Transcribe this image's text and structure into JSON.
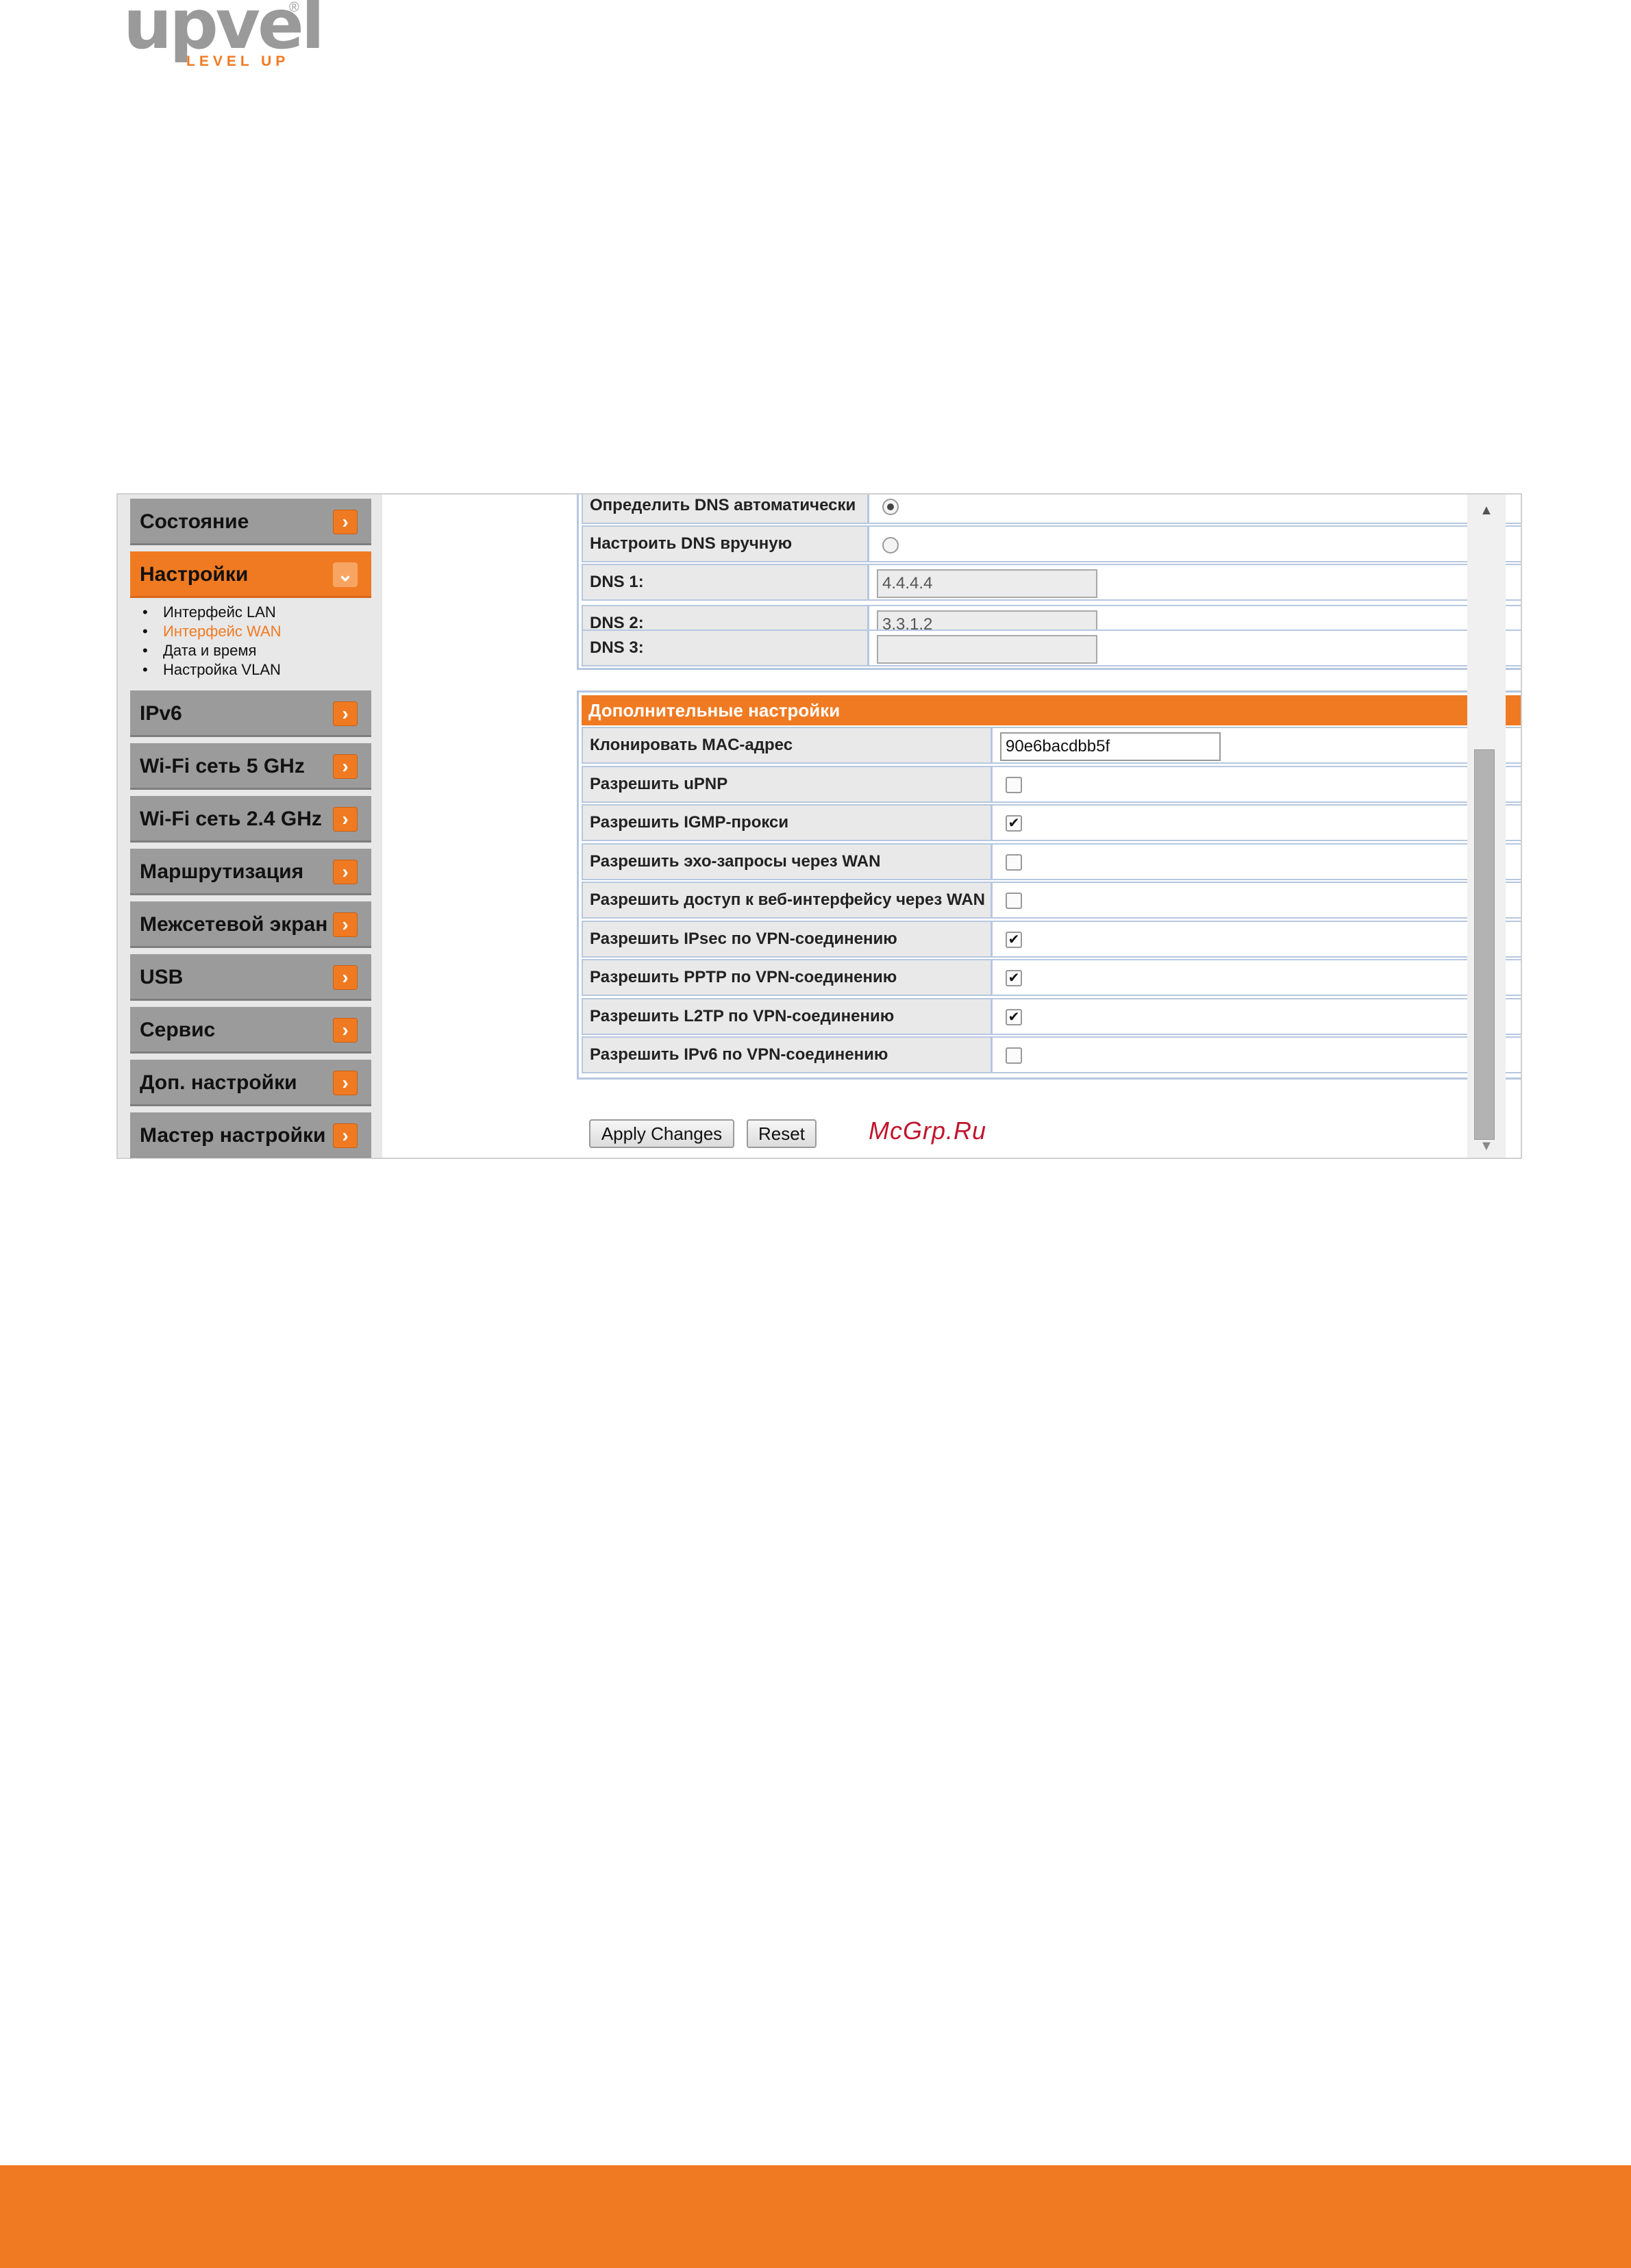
{
  "logo": {
    "brand": "upvel",
    "registered": "®",
    "tagline": "LEVEL UP"
  },
  "sidebar": {
    "items": [
      {
        "label": "Состояние",
        "icon": "chevron-right-icon"
      },
      {
        "label": "Настройки",
        "icon": "chevron-down-icon",
        "active": true
      },
      {
        "label": "IPv6",
        "icon": "chevron-right-icon"
      },
      {
        "label": "Wi-Fi сеть 5 GHz",
        "icon": "chevron-right-icon"
      },
      {
        "label": "Wi-Fi сеть 2.4 GHz",
        "icon": "chevron-right-icon"
      },
      {
        "label": "Маршрутизация",
        "icon": "chevron-right-icon"
      },
      {
        "label": "Межсетевой экран",
        "icon": "chevron-right-icon"
      },
      {
        "label": "USB",
        "icon": "chevron-right-icon"
      },
      {
        "label": "Сервис",
        "icon": "chevron-right-icon"
      },
      {
        "label": "Доп. настройки",
        "icon": "chevron-right-icon"
      },
      {
        "label": "Мастер настройки",
        "icon": "chevron-right-icon"
      }
    ],
    "submenu": [
      {
        "label": "Интерфейс LAN"
      },
      {
        "label": "Интерфейс WAN",
        "current": true
      },
      {
        "label": "Дата и время"
      },
      {
        "label": "Настройка VLAN"
      }
    ]
  },
  "dns": {
    "auto_label": "Определить DNS автоматически",
    "auto_selected": true,
    "manual_label": "Настроить DNS вручную",
    "manual_selected": false,
    "dns1_label": "DNS 1:",
    "dns1_value": "4.4.4.4",
    "dns2_label": "DNS 2:",
    "dns2_value": "3.3.1.2",
    "dns3_label": "DNS 3:",
    "dns3_value": ""
  },
  "advanced": {
    "title": "Дополнительные настройки",
    "clone_mac_label": "Клонировать MAC-адрес",
    "clone_mac_value": "90e6bacdbb5f",
    "options": [
      {
        "label": "Разрешить uPNP",
        "checked": false
      },
      {
        "label": "Разрешить IGMP-прокси",
        "checked": true
      },
      {
        "label": "Разрешить эхо-запросы через WAN",
        "checked": false
      },
      {
        "label": "Разрешить доступ к веб-интерфейсу через WAN",
        "checked": false
      },
      {
        "label": "Разрешить IPsec по VPN-соединению",
        "checked": true
      },
      {
        "label": "Разрешить PPTP по VPN-соединению",
        "checked": true
      },
      {
        "label": "Разрешить L2TP по VPN-соединению",
        "checked": true
      },
      {
        "label": "Разрешить IPv6 по VPN-соединению",
        "checked": false
      }
    ]
  },
  "buttons": {
    "apply": "Apply Changes",
    "reset": "Reset"
  },
  "watermark": "McGrp.Ru",
  "scrollbar": {
    "up": "▲",
    "down": "▼"
  },
  "colors": {
    "accent": "#f07a22",
    "menu_gray": "#9b9b9b",
    "border_blue": "#b6c7e0"
  }
}
